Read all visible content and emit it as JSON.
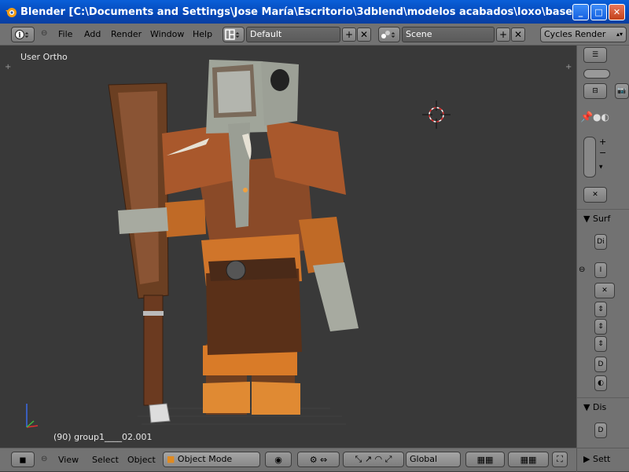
{
  "window": {
    "title": "Blender  [C:\\Documents and Settings\\Jose María\\Escritorio\\3dblend\\modelos acabados\\loxo\\bases\\AFRICANO\\G...",
    "minimize_label": "_",
    "maximize_label": "□",
    "close_label": "✕"
  },
  "header": {
    "menus": [
      "File",
      "Add",
      "Render",
      "Window",
      "Help"
    ],
    "layout_name": "Default",
    "scene_name": "Scene",
    "render_engine": "Cycles Render",
    "add_symbol": "+",
    "remove_symbol": "✕"
  },
  "viewport": {
    "view_label": "User Ortho",
    "object_info": "(90) group1____02.001",
    "corner_plus": "+"
  },
  "properties": {
    "panels": [
      "Surf",
      "Dis",
      "Sett"
    ],
    "button_labels": [
      "Di",
      "I",
      "D",
      "D"
    ],
    "panel_arrow": "▼",
    "collapsed_arrow": "▶"
  },
  "bottom": {
    "menus": [
      "View",
      "Select",
      "Object"
    ],
    "mode": "Object Mode",
    "orientation": "Global"
  },
  "colors": {
    "titlebar": "#0a5fd8",
    "header_bg": "#727272",
    "viewport_bg": "#393939"
  }
}
